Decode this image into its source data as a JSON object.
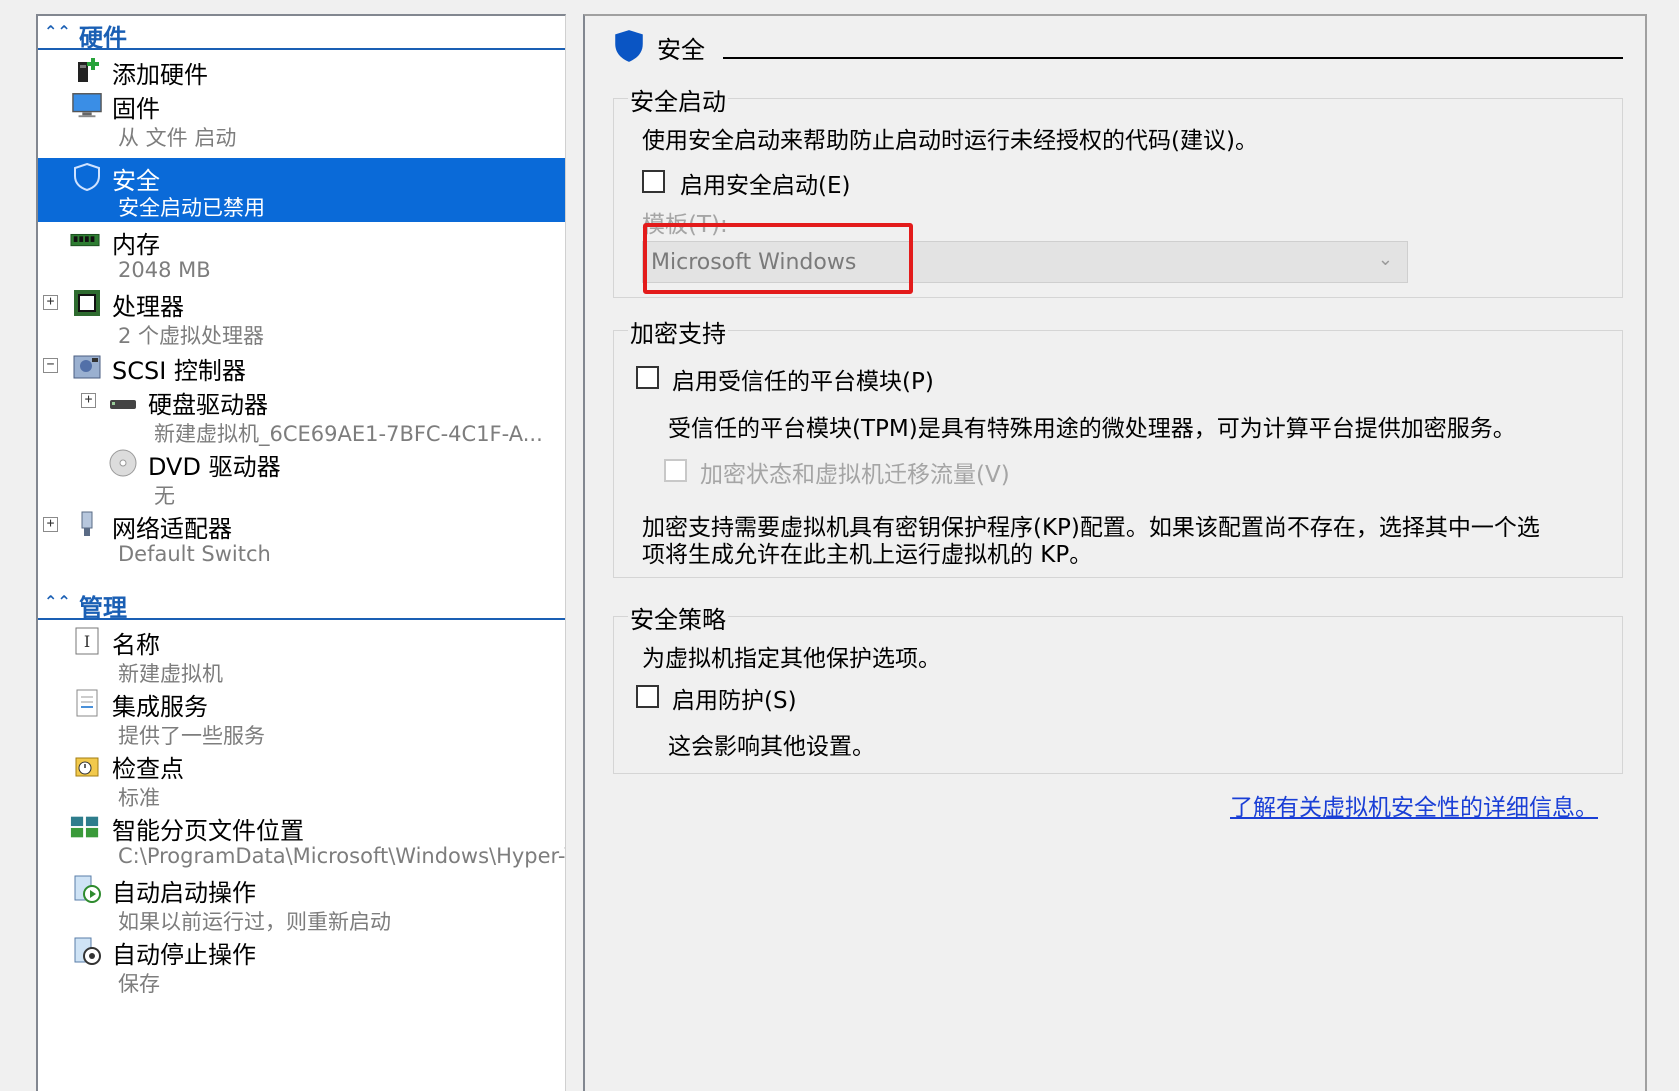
{
  "left": {
    "hardware_header": "硬件",
    "management_header": "管理",
    "items": [
      {
        "label": "添加硬件",
        "sub": ""
      },
      {
        "label": "固件",
        "sub": "从 文件 启动"
      },
      {
        "label": "安全",
        "sub": "安全启动已禁用"
      },
      {
        "label": "内存",
        "sub": "2048 MB"
      },
      {
        "label": "处理器",
        "sub": "2 个虚拟处理器"
      },
      {
        "label": "SCSI 控制器",
        "sub": ""
      },
      {
        "label": "硬盘驱动器",
        "sub": "新建虚拟机_6CE69AE1-7BFC-4C1F-A..."
      },
      {
        "label": "DVD 驱动器",
        "sub": "无"
      },
      {
        "label": "网络适配器",
        "sub": "Default Switch"
      },
      {
        "label": "名称",
        "sub": "新建虚拟机"
      },
      {
        "label": "集成服务",
        "sub": "提供了一些服务"
      },
      {
        "label": "检查点",
        "sub": "标准"
      },
      {
        "label": "智能分页文件位置",
        "sub": "C:\\ProgramData\\Microsoft\\Windows\\Hyper-V"
      },
      {
        "label": "自动启动操作",
        "sub": "如果以前运行过，则重新启动"
      },
      {
        "label": "自动停止操作",
        "sub": "保存"
      }
    ]
  },
  "right": {
    "page_title": "安全",
    "secure_boot": {
      "title": "安全启动",
      "desc": "使用安全启动来帮助防止启动时运行未经授权的代码(建议)。",
      "checkbox_label": "启用安全启动(E)",
      "template_label": "模板(T):",
      "template_value": "Microsoft Windows"
    },
    "encryption": {
      "title": "加密支持",
      "tpm_label": "启用受信任的平台模块(P)",
      "tpm_desc": "受信任的平台模块(TPM)是具有特殊用途的微处理器，可为计算平台提供加密服务。",
      "migrate_label": "加密状态和虚拟机迁移流量(V)",
      "kp_desc_1": "加密支持需要虚拟机具有密钥保护程序(KP)配置。如果该配置尚不存在，选择其中一个选",
      "kp_desc_2": "项将生成允许在此主机上运行虚拟机的 KP。"
    },
    "policy": {
      "title": "安全策略",
      "desc": "为虚拟机指定其他保护选项。",
      "shield_label": "启用防护(S)",
      "shield_desc": "这会影响其他设置。"
    },
    "learn_more": "了解有关虚拟机安全性的详细信息。"
  },
  "colors": {
    "accent": "#1a5fb4",
    "selected": "#0a6ad8",
    "highlight": "#e31b1b",
    "link": "#1a3fd6"
  }
}
